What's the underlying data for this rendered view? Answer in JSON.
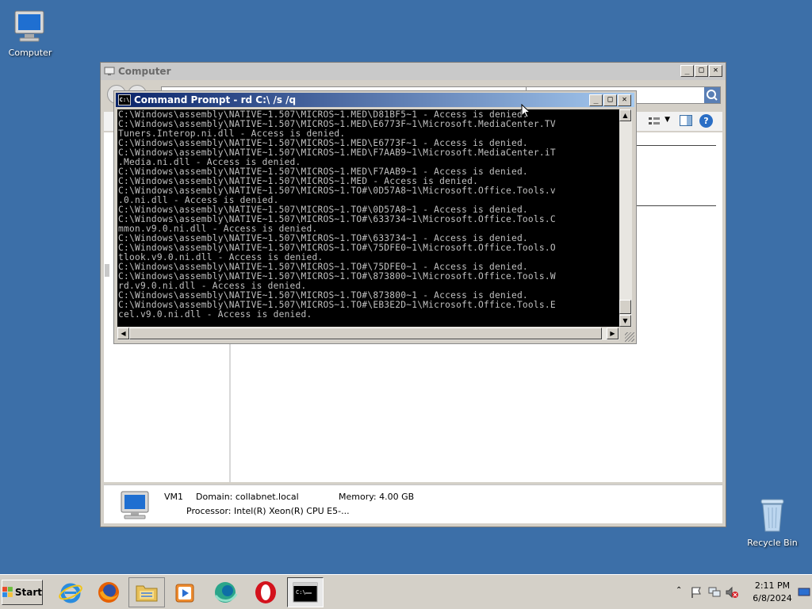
{
  "desktop": {
    "icons": [
      {
        "label": "Computer"
      },
      {
        "label": "Recycle Bin"
      }
    ]
  },
  "explorer": {
    "title": "Computer",
    "details": {
      "name": "VM1",
      "domain": "Domain: collabnet.local",
      "memory": "Memory: 4.00 GB",
      "processor": "Processor: Intel(R) Xeon(R) CPU E5-..."
    }
  },
  "cmd": {
    "title": "Command Prompt - rd  C:\\ /s /q",
    "icon_text": "C:\\",
    "output": "C:\\Windows\\assembly\\NATIVE~1.507\\MICROS~1.MED\\D81BF5~1 - Access is denied.\nC:\\Windows\\assembly\\NATIVE~1.507\\MICROS~1.MED\\E6773F~1\\Microsoft.MediaCenter.TV\nTuners.Interop.ni.dll - Access is denied.\nC:\\Windows\\assembly\\NATIVE~1.507\\MICROS~1.MED\\E6773F~1 - Access is denied.\nC:\\Windows\\assembly\\NATIVE~1.507\\MICROS~1.MED\\F7AAB9~1\\Microsoft.MediaCenter.iT\n.Media.ni.dll - Access is denied.\nC:\\Windows\\assembly\\NATIVE~1.507\\MICROS~1.MED\\F7AAB9~1 - Access is denied.\nC:\\Windows\\assembly\\NATIVE~1.507\\MICROS~1.MED - Access is denied.\nC:\\Windows\\assembly\\NATIVE~1.507\\MICROS~1.TO#\\0D57A8~1\\Microsoft.Office.Tools.v\n.0.ni.dll - Access is denied.\nC:\\Windows\\assembly\\NATIVE~1.507\\MICROS~1.TO#\\0D57A8~1 - Access is denied.\nC:\\Windows\\assembly\\NATIVE~1.507\\MICROS~1.TO#\\633734~1\\Microsoft.Office.Tools.C\nmmon.v9.0.ni.dll - Access is denied.\nC:\\Windows\\assembly\\NATIVE~1.507\\MICROS~1.TO#\\633734~1 - Access is denied.\nC:\\Windows\\assembly\\NATIVE~1.507\\MICROS~1.TO#\\75DFE0~1\\Microsoft.Office.Tools.O\ntlook.v9.0.ni.dll - Access is denied.\nC:\\Windows\\assembly\\NATIVE~1.507\\MICROS~1.TO#\\75DFE0~1 - Access is denied.\nC:\\Windows\\assembly\\NATIVE~1.507\\MICROS~1.TO#\\873800~1\\Microsoft.Office.Tools.W\nrd.v9.0.ni.dll - Access is denied.\nC:\\Windows\\assembly\\NATIVE~1.507\\MICROS~1.TO#\\873800~1 - Access is denied.\nC:\\Windows\\assembly\\NATIVE~1.507\\MICROS~1.TO#\\EB3E2D~1\\Microsoft.Office.Tools.E\ncel.v9.0.ni.dll - Access is denied."
  },
  "taskbar": {
    "start_label": "Start",
    "apps": [
      {
        "name": "internet-explorer-icon"
      },
      {
        "name": "firefox-icon"
      },
      {
        "name": "file-explorer-icon"
      },
      {
        "name": "media-player-icon"
      },
      {
        "name": "browser-icon"
      },
      {
        "name": "opera-icon"
      },
      {
        "name": "command-prompt-icon"
      }
    ],
    "clock_time": "2:11 PM",
    "clock_date": "6/8/2024"
  },
  "colors": {
    "desktop": "#3c6fa8",
    "title_active_start": "#0a246a",
    "title_active_end": "#a6caf0",
    "console_bg": "#000000",
    "console_text": "#c0c0c0"
  }
}
